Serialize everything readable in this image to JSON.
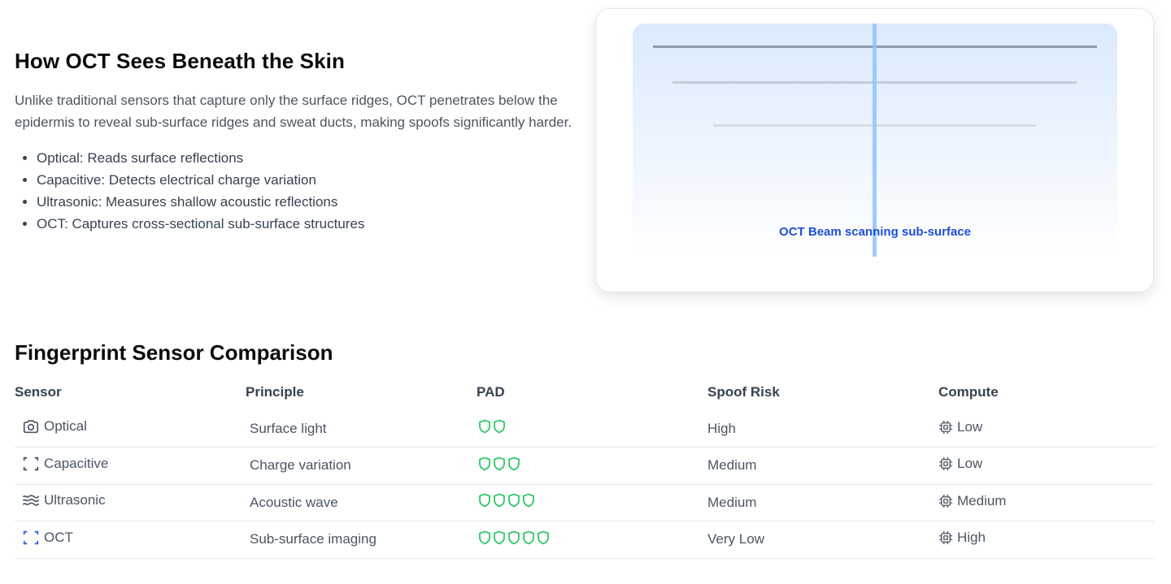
{
  "intro": {
    "title": "How OCT Sees Beneath the Skin",
    "body": "Unlike traditional sensors that capture only the surface ridges, OCT penetrates below the epidermis to reveal sub-surface ridges and sweat ducts, making spoofs significantly harder.",
    "bullets": [
      "Optical: Reads surface reflections",
      "Capacitive: Detects electrical charge variation",
      "Ultrasonic: Measures shallow acoustic reflections",
      "OCT: Captures cross-sectional sub-surface structures"
    ]
  },
  "visual": {
    "caption": "OCT Beam scanning sub-surface"
  },
  "comparison": {
    "title": "Fingerprint Sensor Comparison",
    "headers": [
      "Sensor",
      "Principle",
      "PAD",
      "Spoof Risk",
      "Compute"
    ],
    "rows": [
      {
        "sensor": "Optical",
        "icon": "camera-icon",
        "principle": "Surface light",
        "pad": 2,
        "risk": "High",
        "compute": "Low"
      },
      {
        "sensor": "Capacitive",
        "icon": "scan-frame-icon",
        "principle": "Charge variation",
        "pad": 3,
        "risk": "Medium",
        "compute": "Low"
      },
      {
        "sensor": "Ultrasonic",
        "icon": "waves-icon",
        "principle": "Acoustic wave",
        "pad": 4,
        "risk": "Medium",
        "compute": "Medium"
      },
      {
        "sensor": "OCT",
        "icon": "scan-frame-blue-icon",
        "principle": "Sub-surface imaging",
        "pad": 5,
        "risk": "Very Low",
        "compute": "High"
      }
    ]
  },
  "colors": {
    "accent": "#1d4ed8",
    "shield": "#22c55e",
    "oct_icon": "#2563eb"
  }
}
